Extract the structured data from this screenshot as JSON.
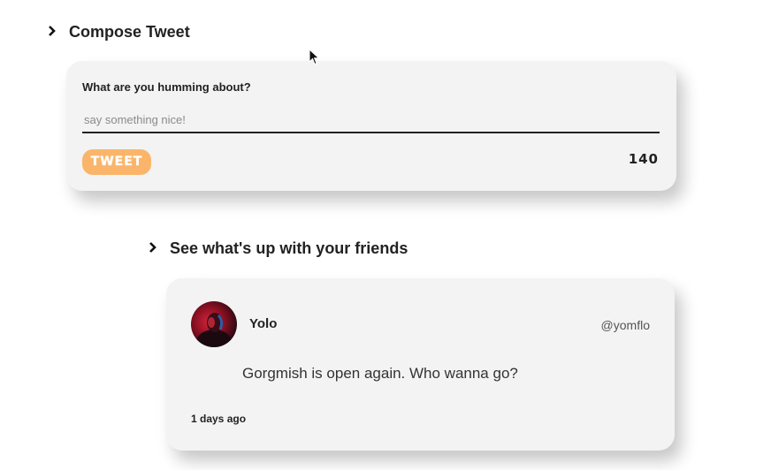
{
  "compose_section": {
    "title": "Compose Tweet",
    "label": "What are you humming about?",
    "placeholder": "say something nice!",
    "button_label": "TWEET",
    "char_count": "140",
    "accent_color": "#fbb56a"
  },
  "feed_section": {
    "title": "See what's up with your friends",
    "tweets": [
      {
        "name": "Yolo",
        "handle": "@yomflo",
        "text": "Gorgmish is open again. Who wanna go?",
        "time": "1 days ago"
      }
    ]
  },
  "icons": {
    "section_toggle": "chevron-right-icon",
    "pointer": "mouse-cursor-icon"
  }
}
